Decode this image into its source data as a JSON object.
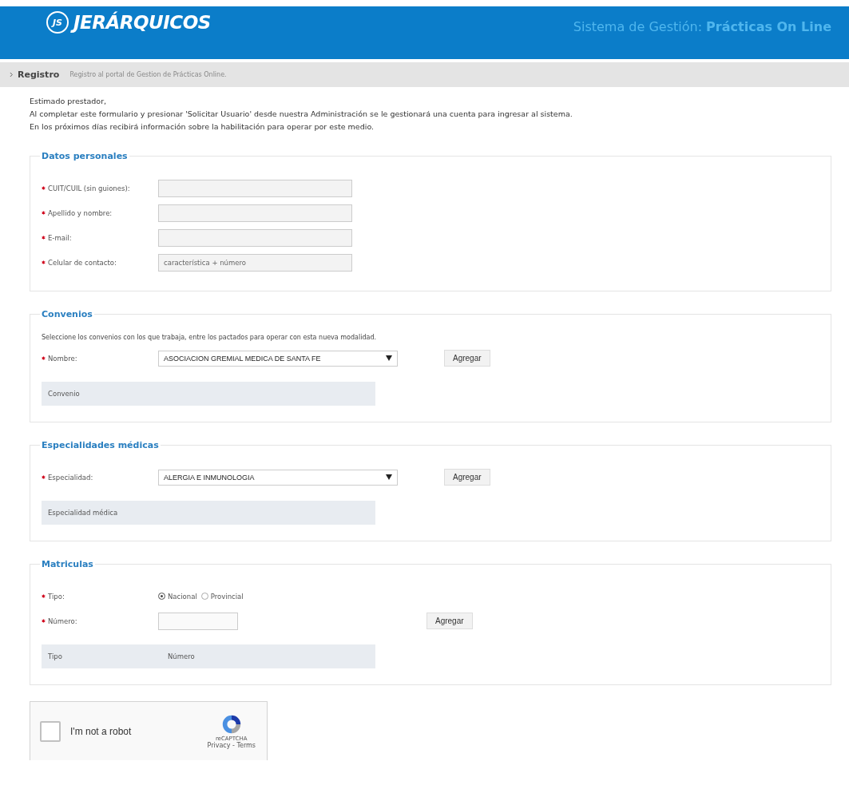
{
  "header": {
    "logo_mark": "JS",
    "logo_text": "JERÁRQUICOS",
    "subtitle": "Sistema de Gestión:",
    "subtitle_emphasis": "Prácticas On Line"
  },
  "breadcrumb": {
    "title": "Registro",
    "description": "Registro al portal de Gestion de Prácticas Online."
  },
  "intro": [
    "Estimado prestador,",
    "Al completar este formulario y presionar 'Solicitar Usuario' desde nuestra Administración se le gestionará una cuenta para ingresar al sistema.",
    "En los próximos días recibirá información sobre la habilitación para operar por este medio."
  ],
  "sections": [
    {
      "legend": "Datos personales",
      "rows": [
        {
          "kind": "input",
          "required": true,
          "label": "CUIT/CUIL (sin guiones):"
        },
        {
          "kind": "input",
          "required": true,
          "label": "Apellido y nombre:"
        },
        {
          "kind": "input",
          "required": true,
          "label": "E-mail:"
        },
        {
          "kind": "input",
          "required": true,
          "label": "Celular de contacto:",
          "placeholder": "característica + número"
        }
      ]
    },
    {
      "legend": "Convenios",
      "description": "Seleccione los convenios con los que trabaja, entre los pactados para operar con esta nueva modalidad.",
      "rows": [
        {
          "kind": "select",
          "required": true,
          "label": "Nombre:",
          "value": "ASOCIACION GREMIAL MEDICA DE SANTA FE",
          "button": "Agregar"
        }
      ],
      "table_columns": [
        "Convenio"
      ]
    },
    {
      "legend": "Especialidades médicas",
      "rows": [
        {
          "kind": "select",
          "required": true,
          "label": "Especialidad:",
          "value": "ALERGIA E INMUNOLOGIA",
          "button": "Agregar"
        }
      ],
      "table_columns": [
        "Especialidad médica"
      ]
    },
    {
      "legend": "Matriculas",
      "rows": [
        {
          "kind": "radio",
          "required": true,
          "label": "Tipo:",
          "options": [
            {
              "label": "Nacional",
              "selected": true
            },
            {
              "label": "Provincial",
              "selected": false
            }
          ]
        },
        {
          "kind": "short_input",
          "required": true,
          "label": "Número:",
          "button": "Agregar"
        }
      ],
      "table_columns": [
        "Tipo",
        "Número"
      ]
    }
  ],
  "captcha": {
    "label": "I'm not a robot",
    "checked": false,
    "brand": "reCAPTCHA",
    "links": "Privacy - Terms"
  }
}
